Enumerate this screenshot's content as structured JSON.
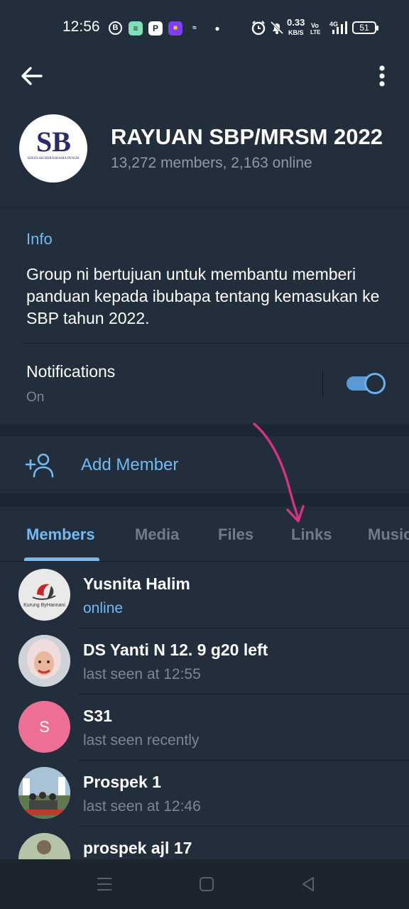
{
  "status_bar": {
    "time": "12:56",
    "net_speed_value": "0.33",
    "net_speed_unit": "KB/S",
    "volte_top": "Vo",
    "volte_bottom": "LTE",
    "signal_label": "4G",
    "battery": "51"
  },
  "header": {
    "group_name": "RAYUAN SBP/MRSM 2022",
    "subtitle": "13,272 members, 2,163 online",
    "avatar_caption": "SEKOLAH BERASRAMA PENUH",
    "avatar_monogram": "SB"
  },
  "info": {
    "label": "Info",
    "description": "Group ni bertujuan untuk membantu memberi panduan kepada ibubapa tentang kemasukan ke SBP tahun 2022.",
    "notifications_label": "Notifications",
    "notifications_value": "On",
    "notifications_enabled": true
  },
  "add_member": {
    "label": "Add Member"
  },
  "tabs": [
    {
      "label": "Members",
      "active": true
    },
    {
      "label": "Media",
      "active": false
    },
    {
      "label": "Files",
      "active": false
    },
    {
      "label": "Links",
      "active": false
    },
    {
      "label": "Music",
      "active": false
    }
  ],
  "members": [
    {
      "name": "Yusnita Halim",
      "status": "online",
      "avatar_caption": "Kurung ByHannani"
    },
    {
      "name": "DS Yanti N 12. 9 g20 left",
      "status": "last seen at 12:55"
    },
    {
      "name": "S31",
      "status": "last seen recently",
      "initial": "S"
    },
    {
      "name": "Prospek 1",
      "status": "last seen at 12:46"
    },
    {
      "name": "prospek ajl 17",
      "status": ""
    }
  ],
  "colors": {
    "accent": "#71baf2",
    "background": "#1d2733",
    "card": "#232e3c",
    "annotation_arrow": "#d63384",
    "s31_avatar": "#ee6f94"
  }
}
